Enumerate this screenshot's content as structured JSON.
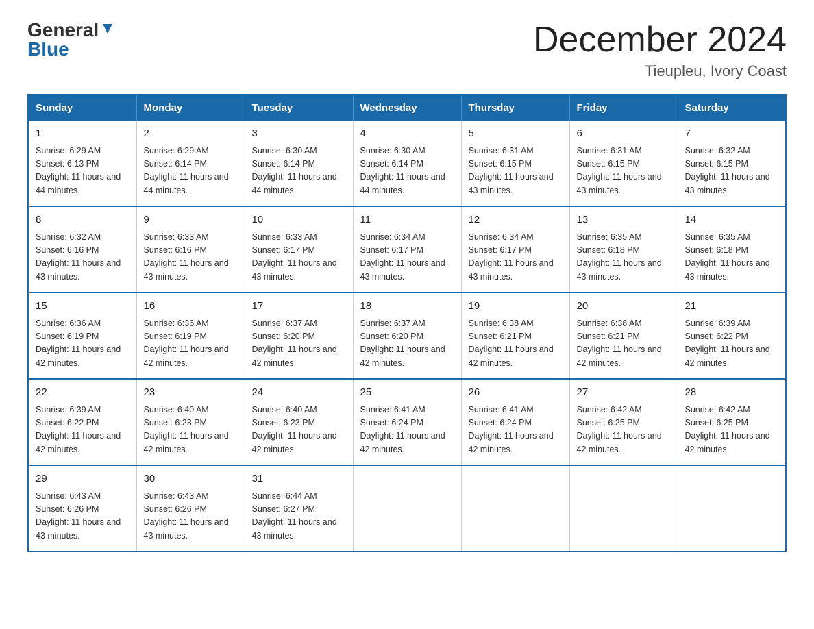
{
  "logo": {
    "general": "General",
    "blue": "Blue"
  },
  "title": {
    "month_year": "December 2024",
    "location": "Tieupleu, Ivory Coast"
  },
  "weekdays": [
    "Sunday",
    "Monday",
    "Tuesday",
    "Wednesday",
    "Thursday",
    "Friday",
    "Saturday"
  ],
  "weeks": [
    [
      {
        "day": "1",
        "sunrise": "6:29 AM",
        "sunset": "6:13 PM",
        "daylight": "11 hours and 44 minutes."
      },
      {
        "day": "2",
        "sunrise": "6:29 AM",
        "sunset": "6:14 PM",
        "daylight": "11 hours and 44 minutes."
      },
      {
        "day": "3",
        "sunrise": "6:30 AM",
        "sunset": "6:14 PM",
        "daylight": "11 hours and 44 minutes."
      },
      {
        "day": "4",
        "sunrise": "6:30 AM",
        "sunset": "6:14 PM",
        "daylight": "11 hours and 44 minutes."
      },
      {
        "day": "5",
        "sunrise": "6:31 AM",
        "sunset": "6:15 PM",
        "daylight": "11 hours and 43 minutes."
      },
      {
        "day": "6",
        "sunrise": "6:31 AM",
        "sunset": "6:15 PM",
        "daylight": "11 hours and 43 minutes."
      },
      {
        "day": "7",
        "sunrise": "6:32 AM",
        "sunset": "6:15 PM",
        "daylight": "11 hours and 43 minutes."
      }
    ],
    [
      {
        "day": "8",
        "sunrise": "6:32 AM",
        "sunset": "6:16 PM",
        "daylight": "11 hours and 43 minutes."
      },
      {
        "day": "9",
        "sunrise": "6:33 AM",
        "sunset": "6:16 PM",
        "daylight": "11 hours and 43 minutes."
      },
      {
        "day": "10",
        "sunrise": "6:33 AM",
        "sunset": "6:17 PM",
        "daylight": "11 hours and 43 minutes."
      },
      {
        "day": "11",
        "sunrise": "6:34 AM",
        "sunset": "6:17 PM",
        "daylight": "11 hours and 43 minutes."
      },
      {
        "day": "12",
        "sunrise": "6:34 AM",
        "sunset": "6:17 PM",
        "daylight": "11 hours and 43 minutes."
      },
      {
        "day": "13",
        "sunrise": "6:35 AM",
        "sunset": "6:18 PM",
        "daylight": "11 hours and 43 minutes."
      },
      {
        "day": "14",
        "sunrise": "6:35 AM",
        "sunset": "6:18 PM",
        "daylight": "11 hours and 43 minutes."
      }
    ],
    [
      {
        "day": "15",
        "sunrise": "6:36 AM",
        "sunset": "6:19 PM",
        "daylight": "11 hours and 42 minutes."
      },
      {
        "day": "16",
        "sunrise": "6:36 AM",
        "sunset": "6:19 PM",
        "daylight": "11 hours and 42 minutes."
      },
      {
        "day": "17",
        "sunrise": "6:37 AM",
        "sunset": "6:20 PM",
        "daylight": "11 hours and 42 minutes."
      },
      {
        "day": "18",
        "sunrise": "6:37 AM",
        "sunset": "6:20 PM",
        "daylight": "11 hours and 42 minutes."
      },
      {
        "day": "19",
        "sunrise": "6:38 AM",
        "sunset": "6:21 PM",
        "daylight": "11 hours and 42 minutes."
      },
      {
        "day": "20",
        "sunrise": "6:38 AM",
        "sunset": "6:21 PM",
        "daylight": "11 hours and 42 minutes."
      },
      {
        "day": "21",
        "sunrise": "6:39 AM",
        "sunset": "6:22 PM",
        "daylight": "11 hours and 42 minutes."
      }
    ],
    [
      {
        "day": "22",
        "sunrise": "6:39 AM",
        "sunset": "6:22 PM",
        "daylight": "11 hours and 42 minutes."
      },
      {
        "day": "23",
        "sunrise": "6:40 AM",
        "sunset": "6:23 PM",
        "daylight": "11 hours and 42 minutes."
      },
      {
        "day": "24",
        "sunrise": "6:40 AM",
        "sunset": "6:23 PM",
        "daylight": "11 hours and 42 minutes."
      },
      {
        "day": "25",
        "sunrise": "6:41 AM",
        "sunset": "6:24 PM",
        "daylight": "11 hours and 42 minutes."
      },
      {
        "day": "26",
        "sunrise": "6:41 AM",
        "sunset": "6:24 PM",
        "daylight": "11 hours and 42 minutes."
      },
      {
        "day": "27",
        "sunrise": "6:42 AM",
        "sunset": "6:25 PM",
        "daylight": "11 hours and 42 minutes."
      },
      {
        "day": "28",
        "sunrise": "6:42 AM",
        "sunset": "6:25 PM",
        "daylight": "11 hours and 42 minutes."
      }
    ],
    [
      {
        "day": "29",
        "sunrise": "6:43 AM",
        "sunset": "6:26 PM",
        "daylight": "11 hours and 43 minutes."
      },
      {
        "day": "30",
        "sunrise": "6:43 AM",
        "sunset": "6:26 PM",
        "daylight": "11 hours and 43 minutes."
      },
      {
        "day": "31",
        "sunrise": "6:44 AM",
        "sunset": "6:27 PM",
        "daylight": "11 hours and 43 minutes."
      },
      null,
      null,
      null,
      null
    ]
  ]
}
